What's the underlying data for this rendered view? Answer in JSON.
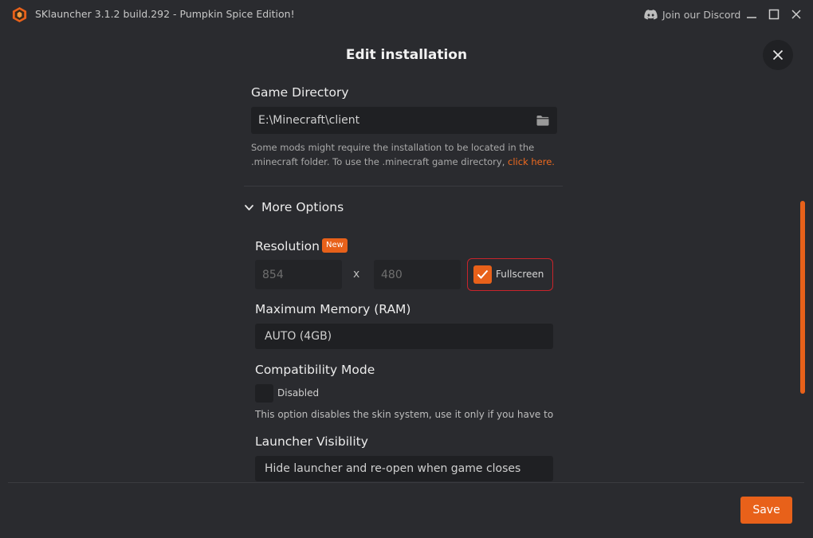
{
  "window": {
    "title": "SKlauncher 3.1.2 build.292 - Pumpkin Spice Edition!",
    "discord_label": "Join our Discord"
  },
  "header": {
    "title": "Edit installation"
  },
  "game_directory": {
    "label": "Game Directory",
    "value": "E:\\Minecraft\\client",
    "help_line1": "Some mods might require the installation to be located in the",
    "help_line2": ".minecraft folder. To use the .minecraft game directory,",
    "help_link": "click here."
  },
  "more_options": {
    "label": "More Options",
    "expanded": true
  },
  "resolution": {
    "label": "Resolution",
    "badge": "New",
    "width_placeholder": "854",
    "separator": "x",
    "height_placeholder": "480",
    "fullscreen_label": "Fullscreen",
    "fullscreen_checked": true
  },
  "memory": {
    "label": "Maximum Memory (RAM)",
    "value": "AUTO (4GB)"
  },
  "compatibility": {
    "label": "Compatibility Mode",
    "checkbox_label": "Disabled",
    "checked": false,
    "help": "This option disables the skin system, use it only if you have to"
  },
  "visibility": {
    "label": "Launcher Visibility",
    "value": "Hide launcher and re-open when game closes"
  },
  "footer": {
    "save_label": "Save"
  },
  "colors": {
    "accent": "#e8611a",
    "background": "#2a2b2f",
    "field": "#1f2023",
    "fullscreen_border": "#c8242b"
  }
}
